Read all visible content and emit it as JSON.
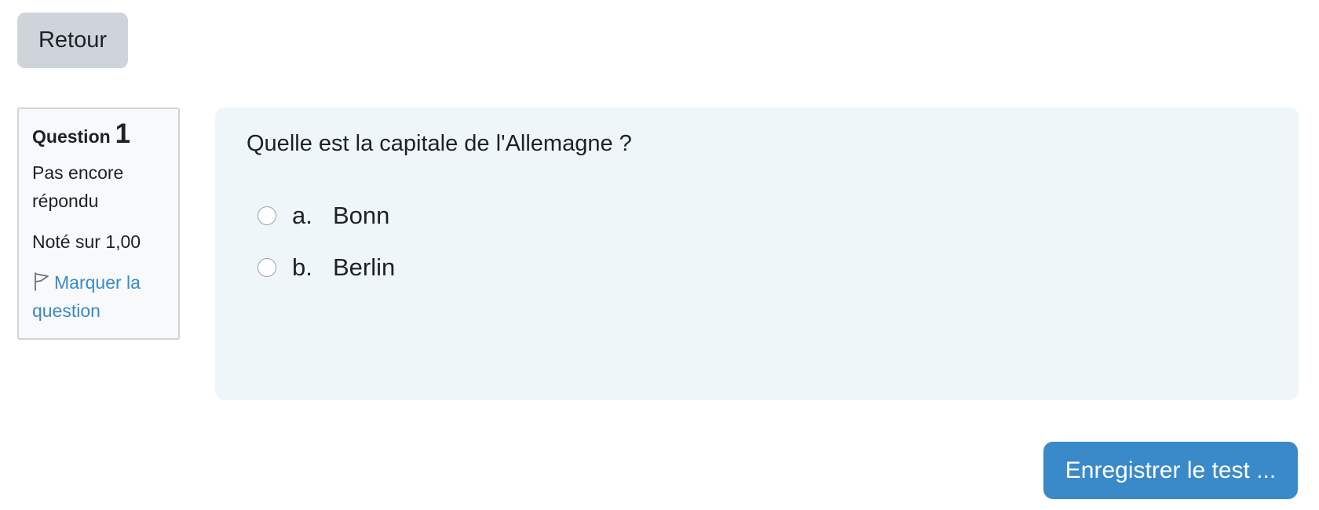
{
  "nav": {
    "back_label": "Retour"
  },
  "question_info": {
    "label": "Question",
    "number": "1",
    "state": "Pas encore répondu",
    "grade": "Noté sur 1,00",
    "flag_label": "Marquer la question",
    "flag_icon": "flag-icon"
  },
  "question": {
    "text": "Quelle est la capitale de l'Allemagne ?",
    "answers": [
      {
        "letter": "a.",
        "text": "Bonn"
      },
      {
        "letter": "b.",
        "text": "Berlin"
      }
    ]
  },
  "footer": {
    "submit_label": "Enregistrer le test ..."
  },
  "colors": {
    "primary": "#3a89c9",
    "secondary_button": "#ced4da",
    "question_panel_bg": "#eff6fa",
    "info_box_bg": "#f8f9fa"
  }
}
